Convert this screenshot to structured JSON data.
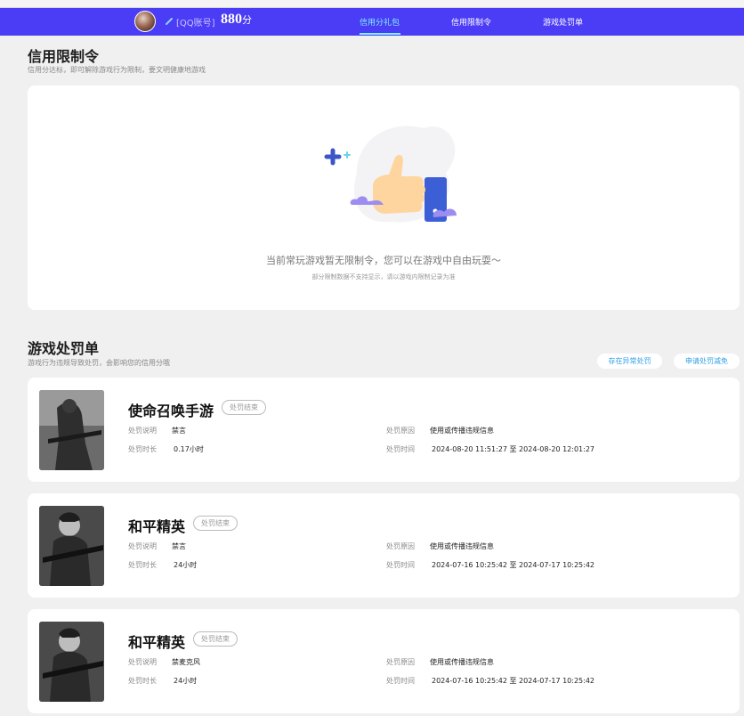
{
  "header": {
    "account_label": "[QQ账号]",
    "score": "880",
    "score_unit": "分",
    "tabs": [
      {
        "label": "信用分礼包",
        "active": true
      },
      {
        "label": "信用限制令",
        "active": false
      },
      {
        "label": "游戏处罚单",
        "active": false
      }
    ],
    "colors": {
      "nav_bg": "#4b3cf5",
      "active_tab": "#7ff0ff"
    }
  },
  "restriction": {
    "title": "信用限制令",
    "subtitle": "信用分达标，即可解除游戏行为限制，要文明健康地游戏",
    "empty_main": "当前常玩游戏暂无限制令，您可以在游戏中自由玩耍～",
    "empty_sub": "部分限制数据不支持显示，请以游戏内限制记录为准",
    "illustration_icon": "thumbs-up-icon"
  },
  "penalty": {
    "title": "游戏处罚单",
    "subtitle": "游戏行为违规导致处罚，会影响您的信用分哦",
    "buttons": {
      "appeal": "存在异常处罚",
      "reduce": "申请处罚减免"
    },
    "labels": {
      "desc": "处罚说明",
      "duration": "处罚时长",
      "reason": "处罚原因",
      "time": "处罚时间"
    },
    "items": [
      {
        "game": "使命召唤手游",
        "status": "处罚结束",
        "desc": "禁言",
        "duration": "0.17小时",
        "reason": "使用或传播违规信息",
        "time": "2024-08-20 11:51:27 至 2024-08-20 12:01:27"
      },
      {
        "game": "和平精英",
        "status": "处罚结束",
        "desc": "禁言",
        "duration": "24小时",
        "reason": "使用或传播违规信息",
        "time": "2024-07-16 10:25:42 至 2024-07-17 10:25:42"
      },
      {
        "game": "和平精英",
        "status": "处罚结束",
        "desc": "禁麦克风",
        "duration": "24小时",
        "reason": "使用或传播违规信息",
        "time": "2024-07-16 10:25:42 至 2024-07-17 10:25:42"
      }
    ]
  }
}
